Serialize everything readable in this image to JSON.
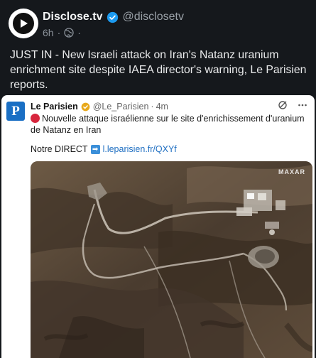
{
  "post": {
    "author_name": "Disclose.tv",
    "handle": "@disclosetv",
    "time": "6h",
    "separator": "·",
    "text": "JUST IN - New Israeli attack on Iran's Natanz uranium enrichment site despite IAEA director's warning, Le Parisien reports."
  },
  "embedded": {
    "logo_letter": "P",
    "author_name": "Le Parisien",
    "handle": "@Le_Parisien",
    "separator": "·",
    "time": "4m",
    "text": "Nouvelle attaque israélienne sur le site d'enrichissement d'uranium de Natanz en Iran",
    "direct_label": "Notre DIRECT",
    "direct_link": "l.leparisien.fr/QXYf",
    "watermark": "MAXAR"
  },
  "colors": {
    "verified": "#1d9bf0",
    "logo_bg": "#1a6fc4",
    "red_dot": "#d7263d",
    "link": "#1f6fc2"
  }
}
